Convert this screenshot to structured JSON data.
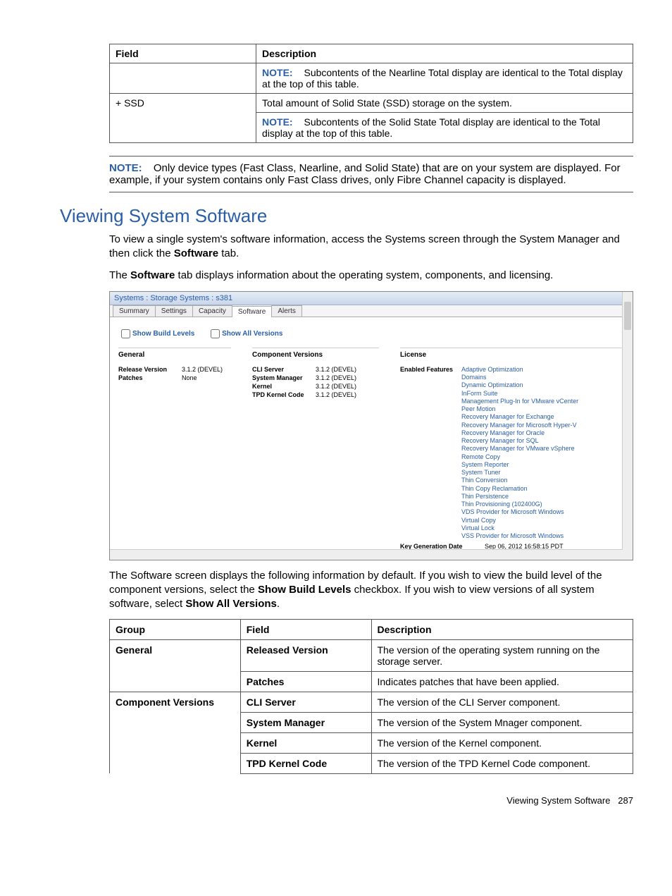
{
  "table1": {
    "headers": [
      "Field",
      "Description"
    ],
    "rows": [
      {
        "field": "",
        "desc_note_prefix": "NOTE:",
        "desc": "Subcontents of the Nearline Total display are identical to the Total display at the top of this table."
      },
      {
        "field": "+ SSD",
        "desc": "Total amount of Solid State (SSD) storage on the system."
      },
      {
        "field": "",
        "desc_note_prefix": "NOTE:",
        "desc": "Subcontents of the Solid State Total display are identical to the Total display at the top of this table."
      }
    ]
  },
  "page_note": {
    "prefix": "NOTE:",
    "text": "Only device types (Fast Class, Nearline, and Solid State) that are on your system are displayed. For example, if your system contains only Fast Class drives, only Fibre Channel capacity is displayed."
  },
  "section_title": "Viewing System Software",
  "paragraph1_a": "To view a single system's software information, access the Systems screen through the System Manager and then click the ",
  "paragraph1_b": "Software",
  "paragraph1_c": " tab.",
  "paragraph2_a": "The ",
  "paragraph2_b": "Software",
  "paragraph2_c": " tab displays information about the operating system, components, and licensing.",
  "screenshot": {
    "title": "Systems : Storage Systems : s381",
    "tabs": [
      "Summary",
      "Settings",
      "Capacity",
      "Software",
      "Alerts"
    ],
    "active_tab": "Software",
    "check1": "Show Build Levels",
    "check2": "Show All Versions",
    "col1_head": "General",
    "col2_head": "Component Versions",
    "col3_head": "License",
    "general": [
      {
        "k": "Release Version",
        "v": "3.1.2 (DEVEL)"
      },
      {
        "k": "Patches",
        "v": "None"
      }
    ],
    "components": [
      {
        "k": "CLI Server",
        "v": "3.1.2 (DEVEL)"
      },
      {
        "k": "System Manager",
        "v": "3.1.2 (DEVEL)"
      },
      {
        "k": "Kernel",
        "v": "3.1.2 (DEVEL)"
      },
      {
        "k": "TPD Kernel Code",
        "v": "3.1.2 (DEVEL)"
      }
    ],
    "license_label": "Enabled Features",
    "features": [
      "Adaptive Optimization",
      "Domains",
      "Dynamic Optimization",
      "InForm Suite",
      "Management Plug-In for VMware vCenter",
      "Peer Motion",
      "Recovery Manager for Exchange",
      "Recovery Manager for Microsoft Hyper-V",
      "Recovery Manager for Oracle",
      "Recovery Manager for SQL",
      "Recovery Manager for VMware vSphere",
      "Remote Copy",
      "System Reporter",
      "System Tuner",
      "Thin Conversion",
      "Thin Copy Reclamation",
      "Thin Persistence",
      "Thin Provisioning (102400G)",
      "VDS Provider for Microsoft Windows",
      "Virtual Copy",
      "Virtual Lock",
      "VSS Provider for Microsoft Windows"
    ],
    "keygen_label": "Key Generation Date",
    "keygen_value": "Sep 06, 2012 16:58:15 PDT"
  },
  "paragraph3_a": "The Software screen displays the following information by default. If you wish to view the build level of the component versions, select the ",
  "paragraph3_b": "Show Build Levels",
  "paragraph3_c": " checkbox. If you wish to view versions of all system software, select ",
  "paragraph3_d": "Show All Versions",
  "paragraph3_e": ".",
  "table2": {
    "headers": [
      "Group",
      "Field",
      "Description"
    ],
    "rows": [
      {
        "group": "General",
        "field": "Released Version",
        "desc": "The version of the operating system running on the storage server."
      },
      {
        "group": "",
        "field": "Patches",
        "desc": "Indicates patches that have been applied."
      },
      {
        "group": "Component Versions",
        "field": "CLI Server",
        "desc": "The version of the CLI Server component."
      },
      {
        "group": "",
        "field": "System Manager",
        "desc": "The version of the System Mnager component."
      },
      {
        "group": "",
        "field": "Kernel",
        "desc": "The version of the Kernel component."
      },
      {
        "group": "",
        "field": "TPD Kernel Code",
        "desc": "The version of the TPD Kernel Code component."
      }
    ]
  },
  "footer_text": "Viewing System Software",
  "footer_page": "287"
}
